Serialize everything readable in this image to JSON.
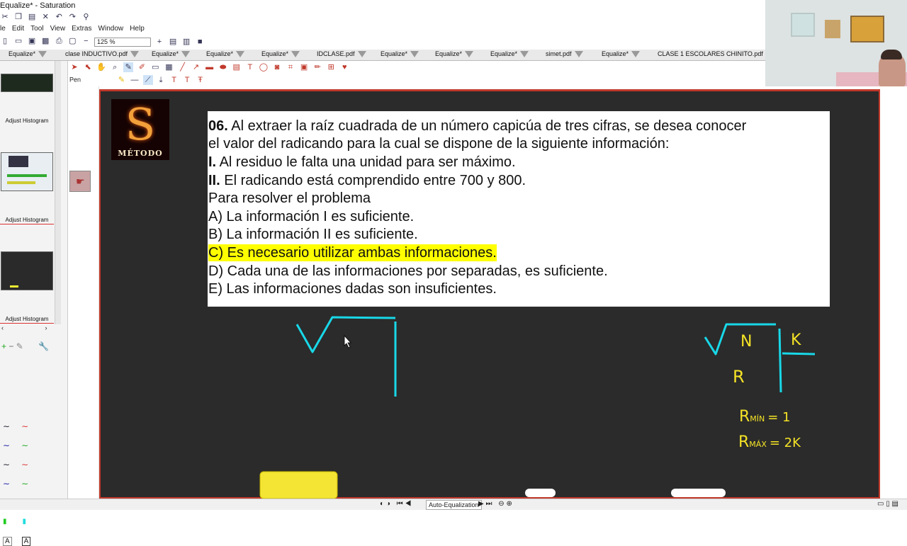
{
  "window": {
    "title": "Equalize* - Saturation"
  },
  "menu": [
    "le",
    "Edit",
    "Tool",
    "View",
    "Extras",
    "Window",
    "Help"
  ],
  "zoom": "125 %",
  "tabs": [
    "Equalize*",
    "clase INDUCTIVO.pdf",
    "Equalize*",
    "Equalize*",
    "Equalize*",
    "IDCLASE.pdf",
    "Equalize*",
    "Equalize*",
    "Equalize*",
    "simet.pdf",
    "Equalize*",
    "CLASE 1 ESCOLARES CHINITO.pdf"
  ],
  "tool_mode": "Pen",
  "left_panel": {
    "labels": [
      "Adjust Histogram",
      "Adjust Histogram",
      "Adjust Histogram"
    ]
  },
  "logo": {
    "letter": "S",
    "caption": "MÉTODO"
  },
  "question": {
    "l1_num": "06.",
    "l1": " Al extraer la raíz cuadrada de un número capicúa de tres cifras, se desea conocer",
    "l2": "el valor del radicando para la cual se dispone de la siguiente información:",
    "l3_num": "I.",
    "l3": "  Al residuo le falta una unidad para ser máximo.",
    "l4_num": "II.",
    "l4": " El radicando está comprendido entre 700 y 800.",
    "l5": "Para resolver el problema",
    "opt_a": "A) La información I es suficiente.",
    "opt_b": "B) La información II es suficiente.",
    "opt_c": "C) Es necesario utilizar ambas informaciones.",
    "opt_d": "D) Cada una de las informaciones por separadas, es suficiente.",
    "opt_e": "E) Las informaciones dadas son insuficientes."
  },
  "handwriting": {
    "n": "N",
    "k": "K",
    "r": "R",
    "rmin": "R",
    "rmin_sub": "MÍN",
    "rmin_val": "= 1",
    "rmax": "R",
    "rmax_sub": "MÁX",
    "rmax_val": "= 2K"
  },
  "status": {
    "mode": "Auto-Equalization"
  },
  "colors": {
    "board": "#2b2b2b",
    "frame": "#c0392b",
    "cyan_ink": "#18d8e8",
    "yellow_ink": "#f5e326",
    "highlight": "#ffff00"
  }
}
